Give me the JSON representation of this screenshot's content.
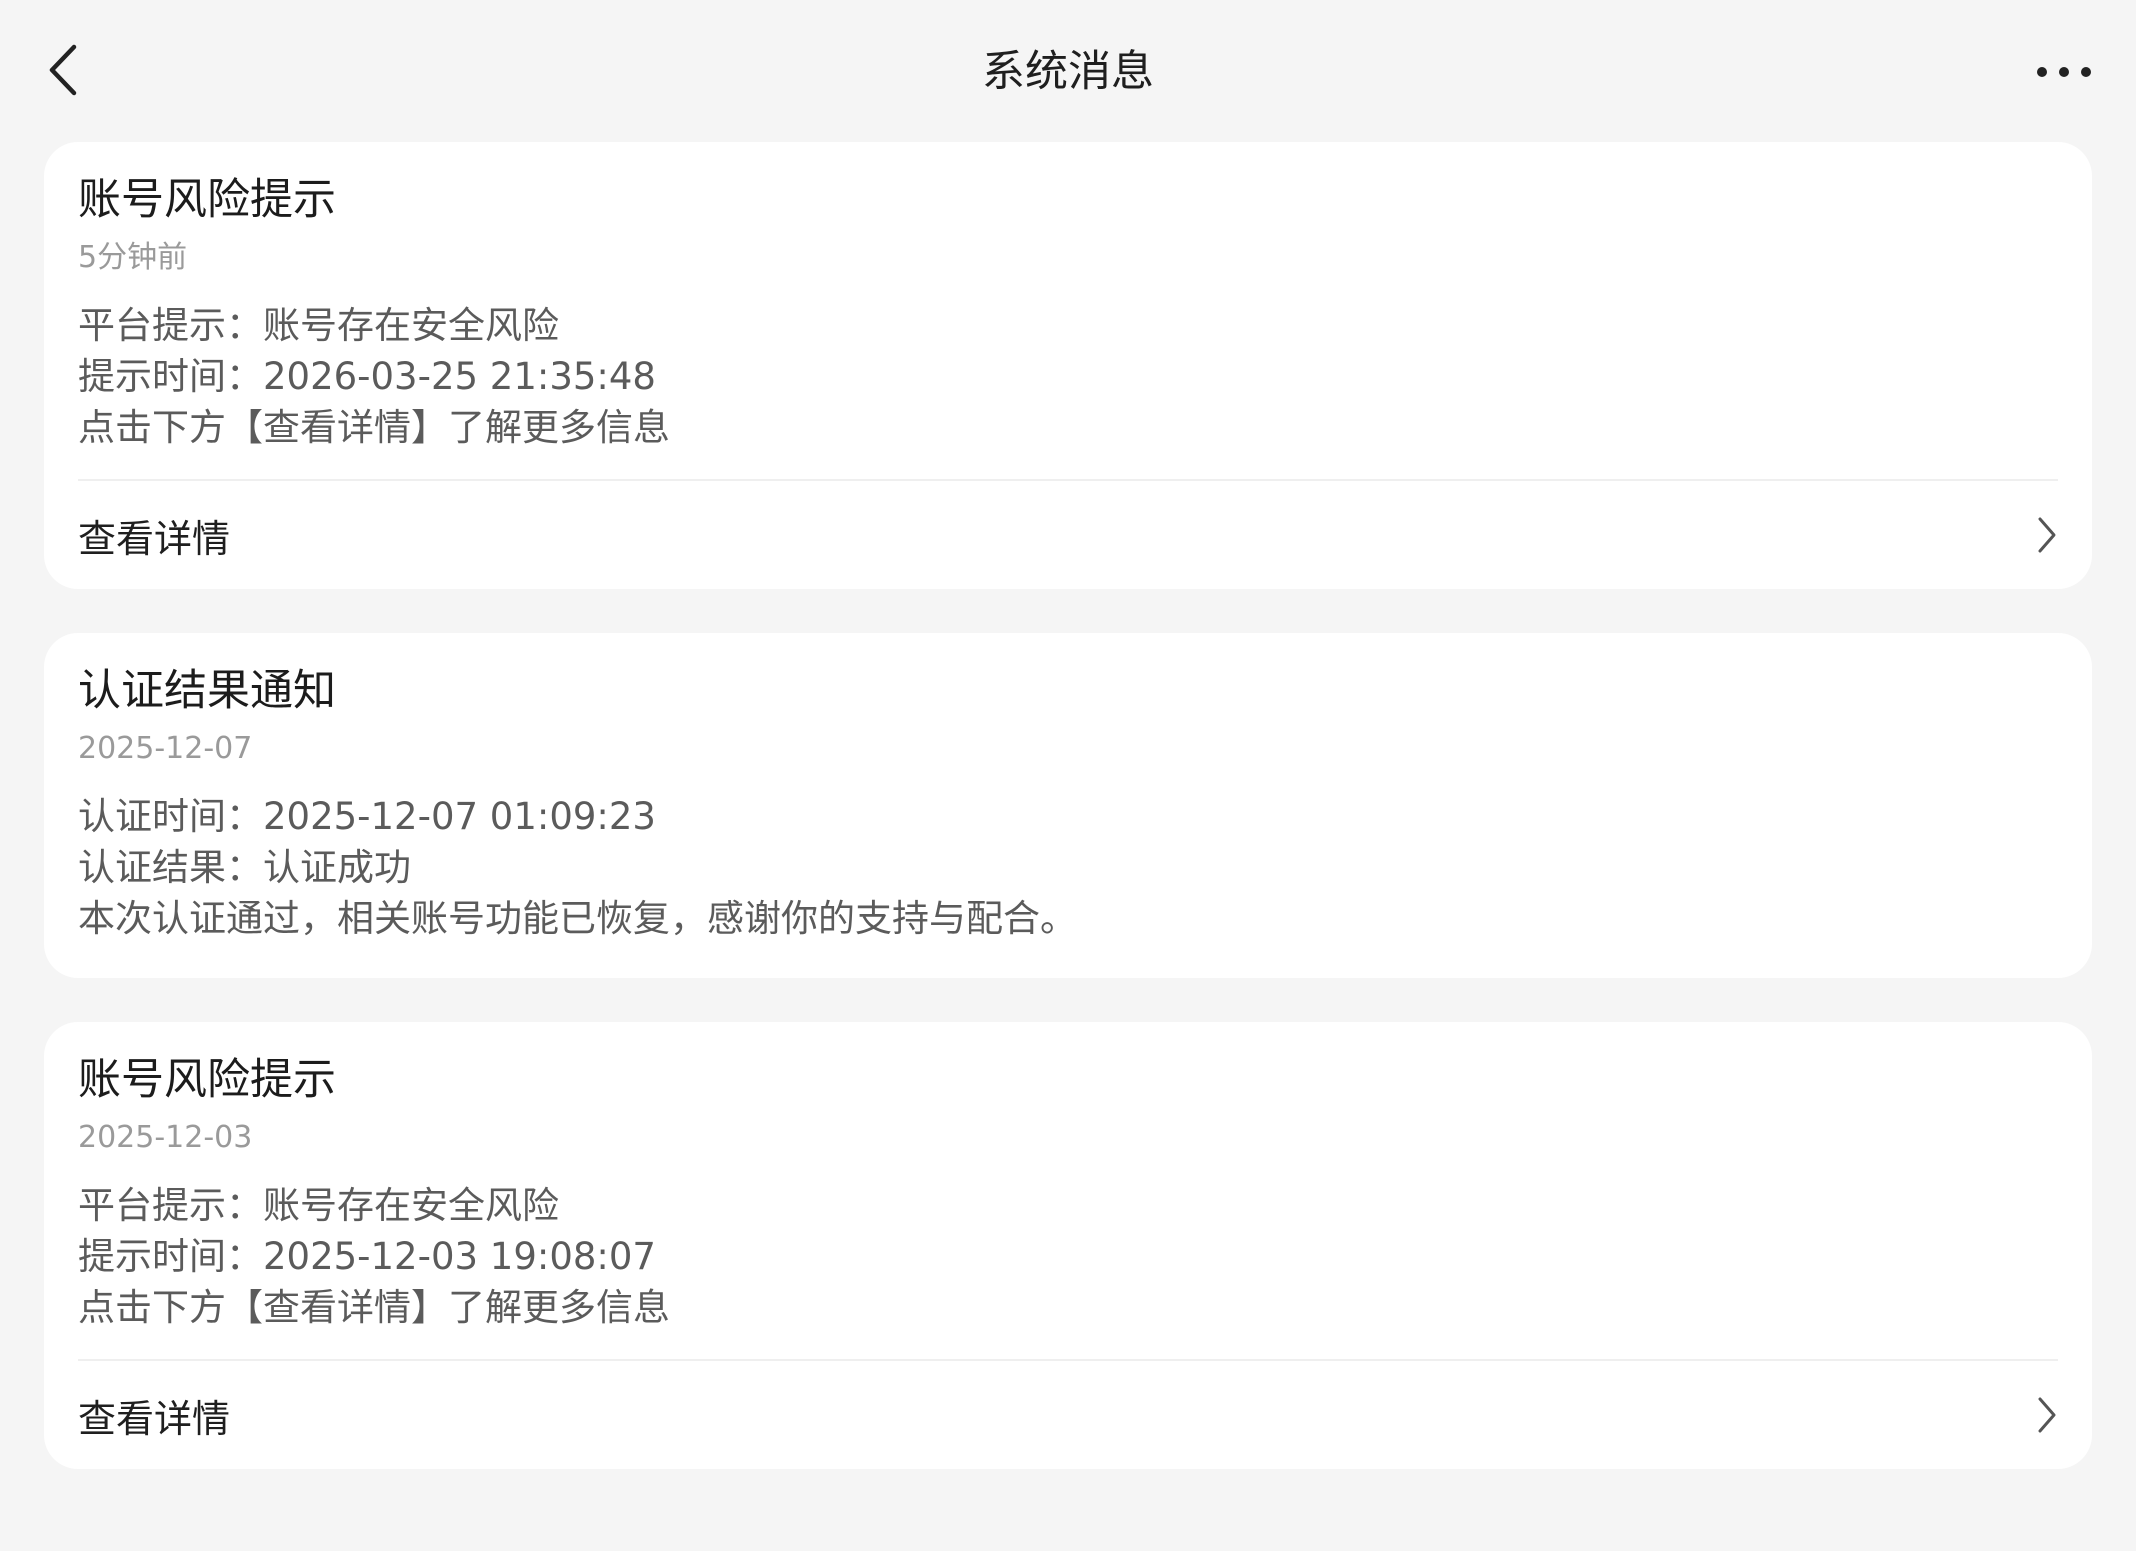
{
  "header": {
    "title": "系统消息",
    "back_icon": "chevron-left-icon",
    "more_icon": "more-horizontal-icon"
  },
  "messages": [
    {
      "title": "账号风险提示",
      "time": "5分钟前",
      "lines": [
        "平台提示：账号存在安全风险",
        "提示时间：2026-03-25 21:35:48",
        "点击下方【查看详情】了解更多信息"
      ],
      "action_label": "查看详情"
    },
    {
      "title": "认证结果通知",
      "time": "2025-12-07",
      "lines": [
        "认证时间：2025-12-07 01:09:23",
        "认证结果：认证成功",
        "本次认证通过，相关账号功能已恢复，感谢你的支持与配合。"
      ]
    },
    {
      "title": "账号风险提示",
      "time": "2025-12-03",
      "lines": [
        "平台提示：账号存在安全风险",
        "提示时间：2025-12-03 19:08:07",
        "点击下方【查看详情】了解更多信息"
      ],
      "action_label": "查看详情"
    }
  ]
}
